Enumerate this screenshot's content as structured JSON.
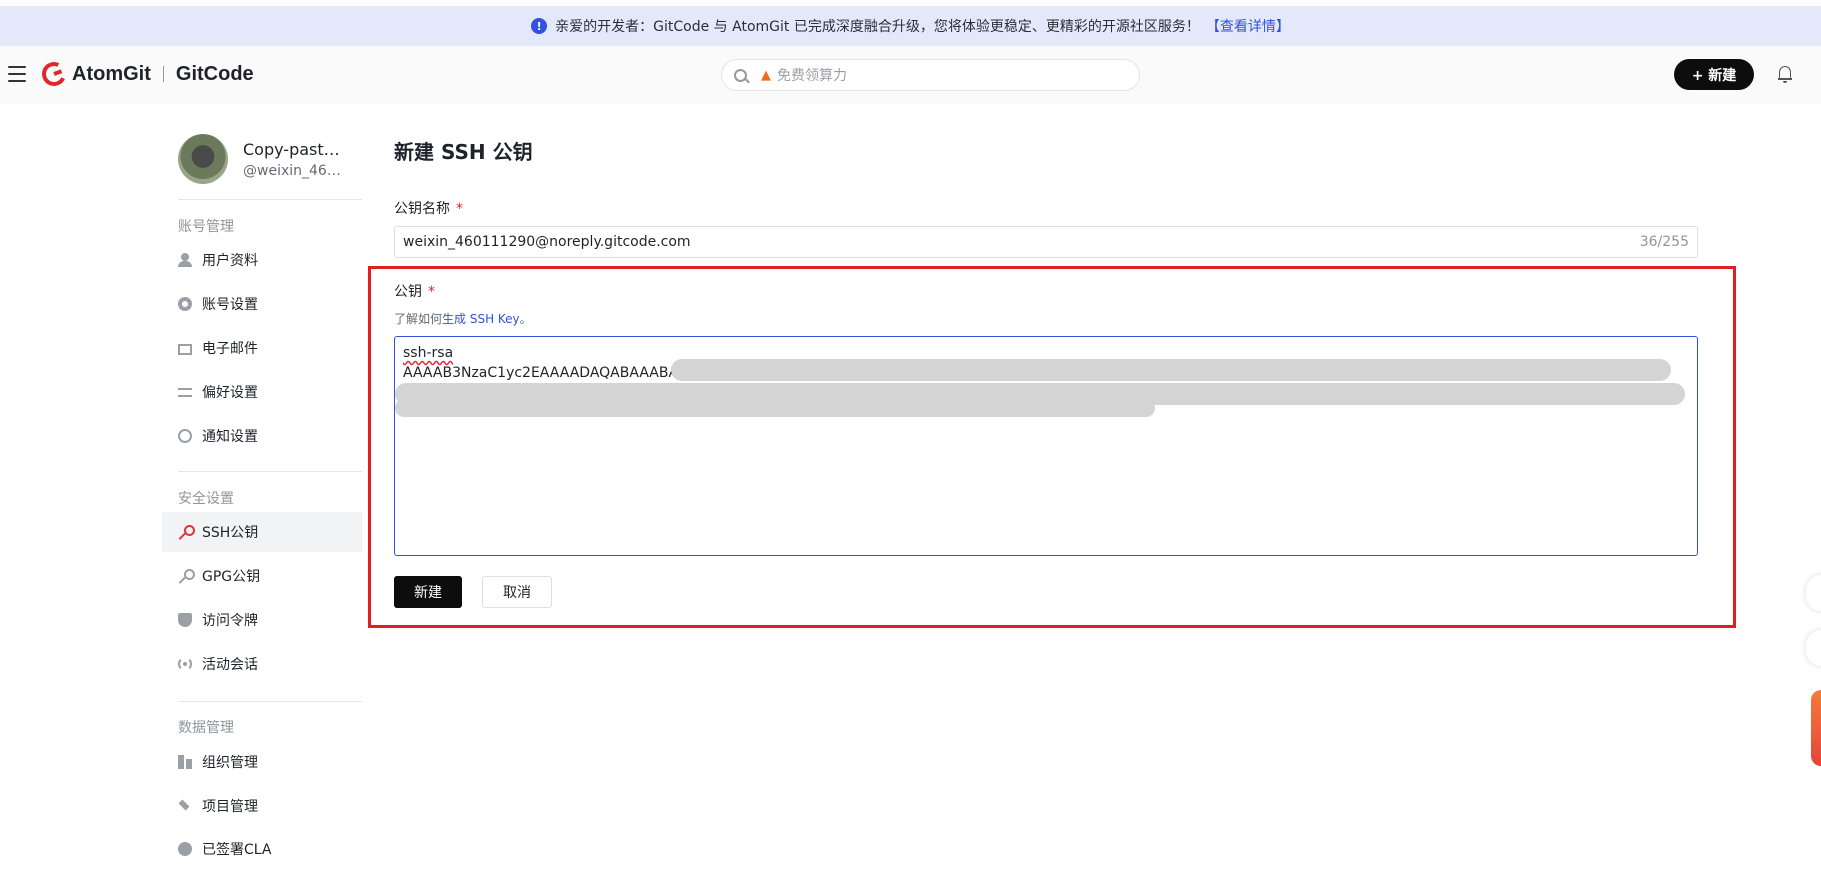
{
  "banner": {
    "text": "亲爱的开发者：GitCode 与 AtomGit 已完成深度融合升级，您将体验更稳定、更精彩的开源社区服务！",
    "link": "【查看详情】",
    "info_icon": "info-icon"
  },
  "header": {
    "brand_left": "AtomGit",
    "brand_right": "GitCode",
    "search_placeholder": "免费领算力",
    "new_button": "+ 新建"
  },
  "sidebar": {
    "profile_name": "Copy-paste…",
    "profile_handle": "@weixin_460…",
    "groups": {
      "account": "账号管理",
      "security": "安全设置",
      "data": "数据管理"
    },
    "items": [
      {
        "label": "用户资料",
        "icon": "user-icon"
      },
      {
        "label": "账号设置",
        "icon": "gear-icon"
      },
      {
        "label": "电子邮件",
        "icon": "mail-icon"
      },
      {
        "label": "偏好设置",
        "icon": "sliders-icon"
      },
      {
        "label": "通知设置",
        "icon": "notification-icon"
      },
      {
        "label": "SSH公钥",
        "icon": "key-icon",
        "active": true
      },
      {
        "label": "GPG公钥",
        "icon": "key-icon"
      },
      {
        "label": "访问令牌",
        "icon": "shield-icon"
      },
      {
        "label": "活动会话",
        "icon": "radio-icon"
      },
      {
        "label": "组织管理",
        "icon": "organization-icon"
      },
      {
        "label": "项目管理",
        "icon": "layers-icon"
      },
      {
        "label": "已签署CLA",
        "icon": "cla-icon"
      }
    ]
  },
  "form": {
    "page_title": "新建 SSH 公钥",
    "name_label": "公钥名称",
    "required_mark": "*",
    "name_value": "weixin_460111290@noreply.gitcode.com",
    "name_count": "36/255",
    "key_label": "公钥",
    "hint_prefix": "了解如何",
    "hint_link": "生成 SSH Key",
    "hint_suffix": "。",
    "key_line1": "ssh-rsa",
    "key_line2": "AAAAB3NzaC1yc2EAAAADAQABAAABAQD",
    "submit": "新建",
    "cancel": "取消"
  },
  "colors": {
    "accent": "#3450e0",
    "brand_red": "#e0252b",
    "highlight_box": "#e0201f",
    "banner_bg": "#e4e8fb"
  }
}
